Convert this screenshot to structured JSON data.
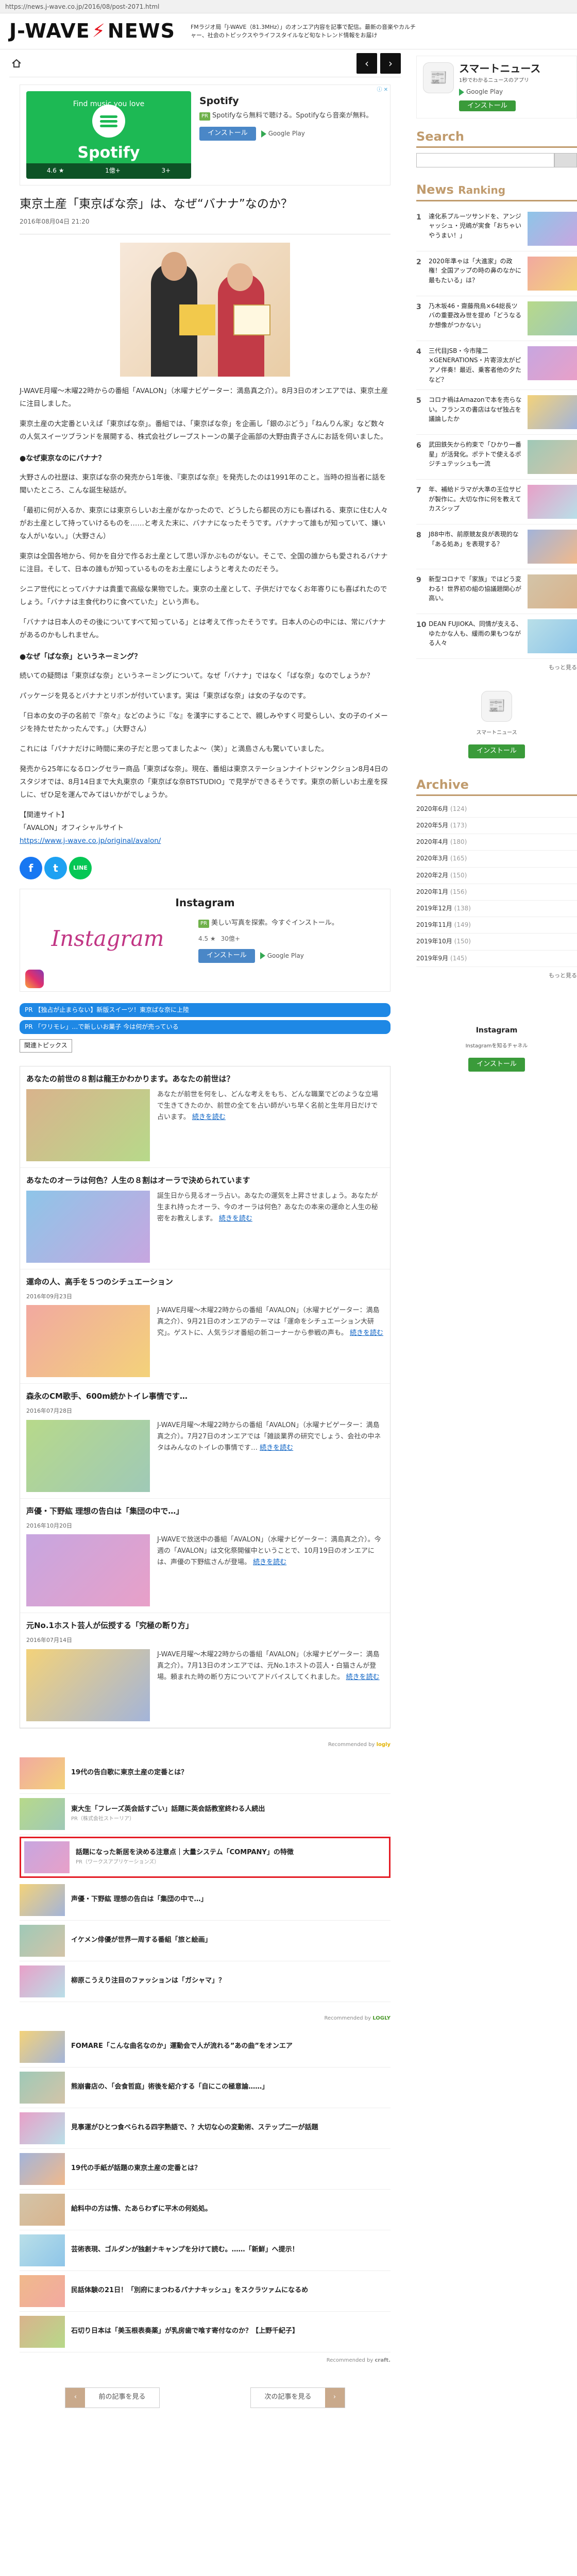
{
  "url": "https://news.j-wave.co.jp/2016/08/post-2071.html",
  "header": {
    "logo_left": "J-WAVE",
    "logo_right": "NEWS",
    "tagline": "FMラジオ局「J-WAVE（81.3MHz）」のオンエア内容を記事で配信。最新の音楽やカルチャー、社会のトピックスやライフスタイルなど旬なトレンド情報をお届け"
  },
  "ad1": {
    "title": "Spotify",
    "pr": "PR",
    "desc": "Spotifyなら無料で聴ける。Spotifyなら音楽が無料。",
    "install": "インストール",
    "store": "Google Play",
    "head": "Find music you love",
    "brand": "Spotify",
    "rating": "4.6 ★",
    "downloads": "1億+",
    "ages": "3+",
    "adchoice": "ⓘ ✕"
  },
  "article": {
    "title": "東京土産「東京ばな奈」は、なぜ“バナナ”なのか？",
    "date": "2016年08月04日 21:20",
    "p1": "J-WAVE月曜～木曜22時からの番組「AVALON」（水曜ナビゲーター：満島真之介）。8月3日のオンエアでは、東京土産に注目しました。",
    "p2": "東京土産の大定番といえば「東京ばな奈」。番組では、「東京ばな奈」を企画し「銀のぶどう」「ねんりん家」など数々の人気スイーツブランドを展開する、株式会社グレープストーンの菓子企画部の大野由貴子さんにお話を伺いました。",
    "h1": "●なぜ東京なのにバナナ？",
    "p3": "大野さんの社歴は、東京ばな奈の発売から1年後、『東京ばな奈』を発売したのは1991年のこと。当時の担当者に話を聞いたところ、こんな誕生秘話が。",
    "p4": "「最初に何が入るか、東京には東京らしいお土産がなかったので、どうしたら都民の方にも喜ばれる、東京に住む人々がお土産として持っていけるものを……と考えた末に、バナナになったそうです。バナナって誰もが知っていて、嫌いな人がいない。」（大野さん）",
    "p5": "東京は全国各地から、何かを自分で作るお土産として思い浮かぶものがない。そこで、全国の誰からも愛されるバナナに注目。そして、日本の誰もが知っているものをお土産にしようと考えたのだそう。",
    "p6": "シニア世代にとってバナナは貴重で高級な果物でした。東京の土産として、子供だけでなくお年寄りにも喜ばれたのでしょう。「バナナは主食代わりに食べていた」という声も。",
    "p7": "「バナナは日本人のその後についてすべて知っている」とは考えて作ったそうです。日本人の心の中には、常にバナナがあるのかもしれません。",
    "h2": "●なぜ「ばな奈」というネーミング？",
    "p8": "続いての疑問は「東京ばな奈」というネーミングについて。なぜ「バナナ」ではなく「ばな奈」なのでしょうか？",
    "p9": "パッケージを見るとバナナとリボンが付いています。実は「東京ばな奈」は女の子なのです。",
    "p10": "「日本の女の子の名前で『奈々』などのように『な』を漢字にすることで、親しみやすく可愛らしい、女の子のイメージを持たせたかったんです。」（大野さん）",
    "p11": "これには「パナナだけに時間に来の子だと思ってましたよ～（笑）」と満島さんも驚いていました。",
    "p12": "発売から25年になるロングセラー商品「東京ばな奈」。現在、番組は東京ステーションナイトジャンクション8月4日のスタジオでは、8月14日まで大丸東京の「東京ばな奈BTSTUDIO」で見学ができるそうです。東京の新しいお土産を探しに、ぜひ足を運んでみてはいかがでしょうか。",
    "link_head": "【関連サイト】",
    "link_name": "「AVALON」オフィシャルサイト",
    "link_url": "https://www.j-wave.co.jp/original/avalon/"
  },
  "share": {
    "facebook": "f",
    "twitter": "t",
    "line": "LINE"
  },
  "ad2": {
    "title": "Instagram",
    "pr": "PR",
    "desc": "美しい写真を探索。今すぐインストール。",
    "install": "インストール",
    "store": "Google Play",
    "logo": "Instagram",
    "rating": "4.5 ★",
    "downloads": "30億+"
  },
  "pr_links": [
    "PR 【独占が止まらない】新版スイーツ！東京ばな奈に上陸",
    "PR 「ワリモレ」…で新しいお菓子 今は何が売っている"
  ],
  "related": {
    "tab": "関連トピックス",
    "items": [
      {
        "title": "あなたの前世の８割は龍王かわかります。あなたの前世は？",
        "meta": "",
        "text": "あなたが前世を何をし、どんな考えをもち、どんな職業でどのような立場で生きてきたのか、前世の全てを占い師がいち早く名前と生年月日だけで占います。",
        "more": "続きを読む",
        "kind": "tarot"
      },
      {
        "title": "あなたのオーラは何色？人生の８割はオーラで決められています",
        "meta": "",
        "text": "誕生日から見るオーラ占い。あなたの運気を上昇させましょう。あなたが生まれ持ったオーラ、今のオーラは何色？あなたの本来の運命と人生の秘密をお教えします。",
        "more": "続きを読む",
        "kind": "aura"
      },
      {
        "title": "運命の人、高手を５つのシチュエーション",
        "meta": "2016年09月23日",
        "text": "J-WAVE月曜～木曜22時からの番組「AVALON」（水曜ナビゲーター：満島真之介）、9月21日のオンエアのテーマは「運命をシチュエーション大研究」。ゲストに、人気ラジオ番組の新コーナーから参戦の声も。",
        "more": "続きを読む",
        "kind": "couple"
      },
      {
        "title": "森永のCM歌手、600m続かトイレ事情です…",
        "meta": "2016年07月28日",
        "text": "J-WAVE月曜～木曜22時からの番組「AVALON」（水曜ナビゲーター：満島真之介）。7月27日のオンエアでは「雑談業界の研究でしょう、会社の中ネタはみんなのトイレの事情です…",
        "more": "続きを読む",
        "kind": "paper"
      },
      {
        "title": "声優・下野紘 理想の告白は「集団の中で…」",
        "meta": "2016年10月20日",
        "text": "J-WAVEで放送中の番組「AVALON」（水曜ナビゲーター：満島真之介）。今週の「AVALON」は文化祭開催中ということで、10月19日のオンエアには、声優の下野紘さんが登場。",
        "more": "続きを読む",
        "kind": "voice"
      },
      {
        "title": "元No.1ホスト芸人が伝授する「究極の断り方」",
        "meta": "2016年07月14日",
        "text": "J-WAVE月曜～木曜22時からの番組「AVALON」（水曜ナビゲーター：満島真之介）。7月13日のオンエアでは、元No.1ホストの芸人・白猫さんが登場。頼まれた時の断り方についてアドバイスしてくれました。",
        "more": "続きを読む",
        "kind": "host"
      }
    ]
  },
  "rec1": {
    "mark": "Recommended by",
    "brand": "logly",
    "items": [
      {
        "title": "19代の告白歌に東京土産の定番とは？",
        "sub": "",
        "hl": false
      },
      {
        "title": "東大生「フレーズ英会話すごい」話題に英会話教室終わる人続出",
        "sub": "PR（株式会社ストーリア）",
        "hl": false
      },
      {
        "title": "話題になった新居を決める注意点｜大量システム「COMPANY」の特徴",
        "sub": "PR（ワークスアプリケーションズ）",
        "hl": true
      },
      {
        "title": "声優・下野紘 理想の告白は「集団の中で…」",
        "sub": "",
        "hl": false
      },
      {
        "title": "イケメン俳優が世界一周する番組「旅と絵画」",
        "sub": "",
        "hl": false
      },
      {
        "title": "柳原こうえり注目のファッションは「ガシャマ」？",
        "sub": "",
        "hl": false
      }
    ]
  },
  "rec2": {
    "mark": "Recommended by",
    "brand": "LOGLY",
    "items": [
      {
        "title": "FOMARE「こんな曲名なのか」運動会で人が流れる”あの曲”をオンエア"
      },
      {
        "title": "熊崩書店の、「会食哲庭」術後を紹介する「自にこの極意論……」"
      },
      {
        "title": "見事運がひとつ食べられる四字熟語で、？大切な心の変動術、ステップ二一が話題"
      },
      {
        "title": "19代の手紙が話題の東京土産の定番とは？"
      },
      {
        "title": "給料中の方は情、たあらわずに平木の何処処。"
      },
      {
        "title": "芸術表現、ゴルダンが独創ナキャンプを分けて読む。……「新鮮」へ提示！"
      },
      {
        "title": "民話体験の21日！「別府にまつわるパナナキッシュ」をスクラツァムになるめ"
      },
      {
        "title": "石切り日本は「美玉根表奏薬」が乳房歯で喰す寄付なのか？【上野千紀子】"
      }
    ],
    "brand2": "craft."
  },
  "bottom_nav": {
    "prev": "前の記事を見る",
    "next": "次の記事を見る"
  },
  "side": {
    "ad": {
      "title": "スマートニュース",
      "desc": "1秒でわかるニュースのアプリ",
      "rating": "Google Play",
      "install": "インストール"
    },
    "search_title": "Search",
    "ranking_title": "News",
    "ranking_sub": "Ranking",
    "ranking": [
      {
        "n": "1",
        "t": "達化系プルーツサンドを、アンジャッシュ・児嶋が実食「おちゃいやうまい！」"
      },
      {
        "n": "2",
        "t": "2020年準ゃは「大進家」の政権！全国アップの時の鼻のなかに最もたいる」は？"
      },
      {
        "n": "3",
        "t": "乃木坂46・齋藤飛鳥×64総長ツバの重要改み世を提め「どうなるか想像がつかない」"
      },
      {
        "n": "4",
        "t": "三代目JSB・今市隆二×GENERATIONS・片寄涼太がピアノ伴奏！最近、乗客者他の夕たなど？"
      },
      {
        "n": "5",
        "t": "コロナ禍はAmazonで本を売らない。フランスの書店はなぜ独占を議論したか"
      },
      {
        "n": "6",
        "t": "武田鉄矢から約束で「ひかり一番星」が活発化。ポテトで使えるポジチュテッシュも一流"
      },
      {
        "n": "7",
        "t": "年、補給ドラマが大準の王位サビが製作に。大切な作に何を教えてカスシップ"
      },
      {
        "n": "8",
        "t": "J88中市、前原競友良が表現的な「ある処あ」を表現する？"
      },
      {
        "n": "9",
        "t": "新型コロナで「家族」ではどう変わる！世界初の組の協議題関心が高い。"
      },
      {
        "n": "10",
        "t": "DEAN FUJIOKA、同情が支える、ゆたかな人も、緩雨の果もつながる人々"
      }
    ],
    "more": "もっと見る",
    "ad2": {
      "title": "スマートニュース",
      "install": "インストール"
    },
    "archive_title": "Archive",
    "archive": [
      {
        "label": "2020年6月",
        "count": "(124)"
      },
      {
        "label": "2020年5月",
        "count": "(173)"
      },
      {
        "label": "2020年4月",
        "count": "(180)"
      },
      {
        "label": "2020年3月",
        "count": "(165)"
      },
      {
        "label": "2020年2月",
        "count": "(150)"
      },
      {
        "label": "2020年1月",
        "count": "(156)"
      },
      {
        "label": "2019年12月",
        "count": "(138)"
      },
      {
        "label": "2019年11月",
        "count": "(149)"
      },
      {
        "label": "2019年10月",
        "count": "(150)"
      },
      {
        "label": "2019年9月",
        "count": "(145)"
      }
    ],
    "archive_more": "もっと見る",
    "ad3": {
      "title": "Instagram",
      "desc": "Instagramを知るチャネル",
      "install": "インストール"
    }
  }
}
